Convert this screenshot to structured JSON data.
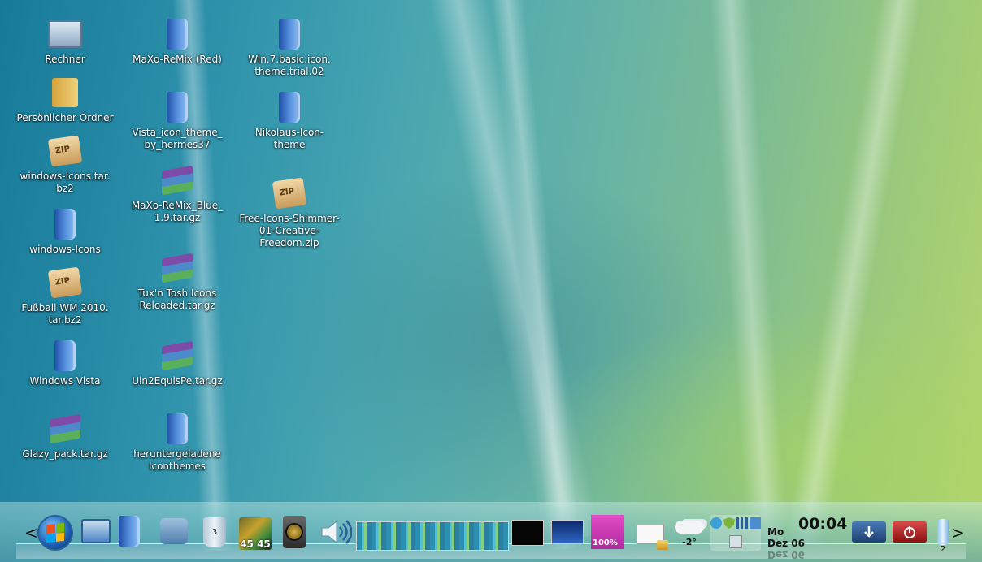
{
  "desktop": {
    "icons": [
      {
        "label": "Rechner",
        "icon": "computer-icon"
      },
      {
        "label": "Persönlicher Ordner",
        "icon": "home-folder-icon"
      },
      {
        "label": "windows-Icons.tar.\nbz2",
        "icon": "zip-archive-icon"
      },
      {
        "label": "windows-Icons",
        "icon": "folder-icon"
      },
      {
        "label": "Fußball WM 2010.\ntar.bz2",
        "icon": "zip-archive-icon"
      },
      {
        "label": "Windows Vista",
        "icon": "folder-icon"
      },
      {
        "label": "Glazy_pack.tar.gz",
        "icon": "rar-archive-icon"
      },
      {
        "label": "MaXo-ReMix (Red)",
        "icon": "folder-icon"
      },
      {
        "label": "Vista_icon_theme_\nby_hermes37",
        "icon": "folder-icon"
      },
      {
        "label": "MaXo-ReMix_Blue_\n1.9.tar.gz",
        "icon": "rar-archive-icon"
      },
      {
        "label": "Tux'n Tosh Icons\nReloaded.tar.gz",
        "icon": "rar-archive-icon"
      },
      {
        "label": "Uin2EquisPe.tar.gz",
        "icon": "rar-archive-icon"
      },
      {
        "label": "heruntergeladene\nIconthemes",
        "icon": "folder-icon"
      },
      {
        "label": "Win.7.basic.icon.\ntheme.trial.02",
        "icon": "folder-icon"
      },
      {
        "label": "Nikolaus-Icon-\ntheme",
        "icon": "folder-icon"
      },
      {
        "label": "Free-Icons-Shimmer-\n01-Creative-\nFreedom.zip",
        "icon": "zip-archive-icon"
      }
    ]
  },
  "taskbar": {
    "scroll_left": "<",
    "scroll_right": ">",
    "trash_count": "3",
    "meter_values": "45 45",
    "battery_percent": "100%",
    "temperature": "-2°",
    "clock_time": "00:04",
    "clock_day": "Mo",
    "clock_date": "Dez 06",
    "clock_date_reflection": "Dez 06",
    "pager_number": "2",
    "colors": {
      "accent": "#2b5f9a",
      "logout": "#b01a1a",
      "download": "#2a4f86"
    }
  }
}
